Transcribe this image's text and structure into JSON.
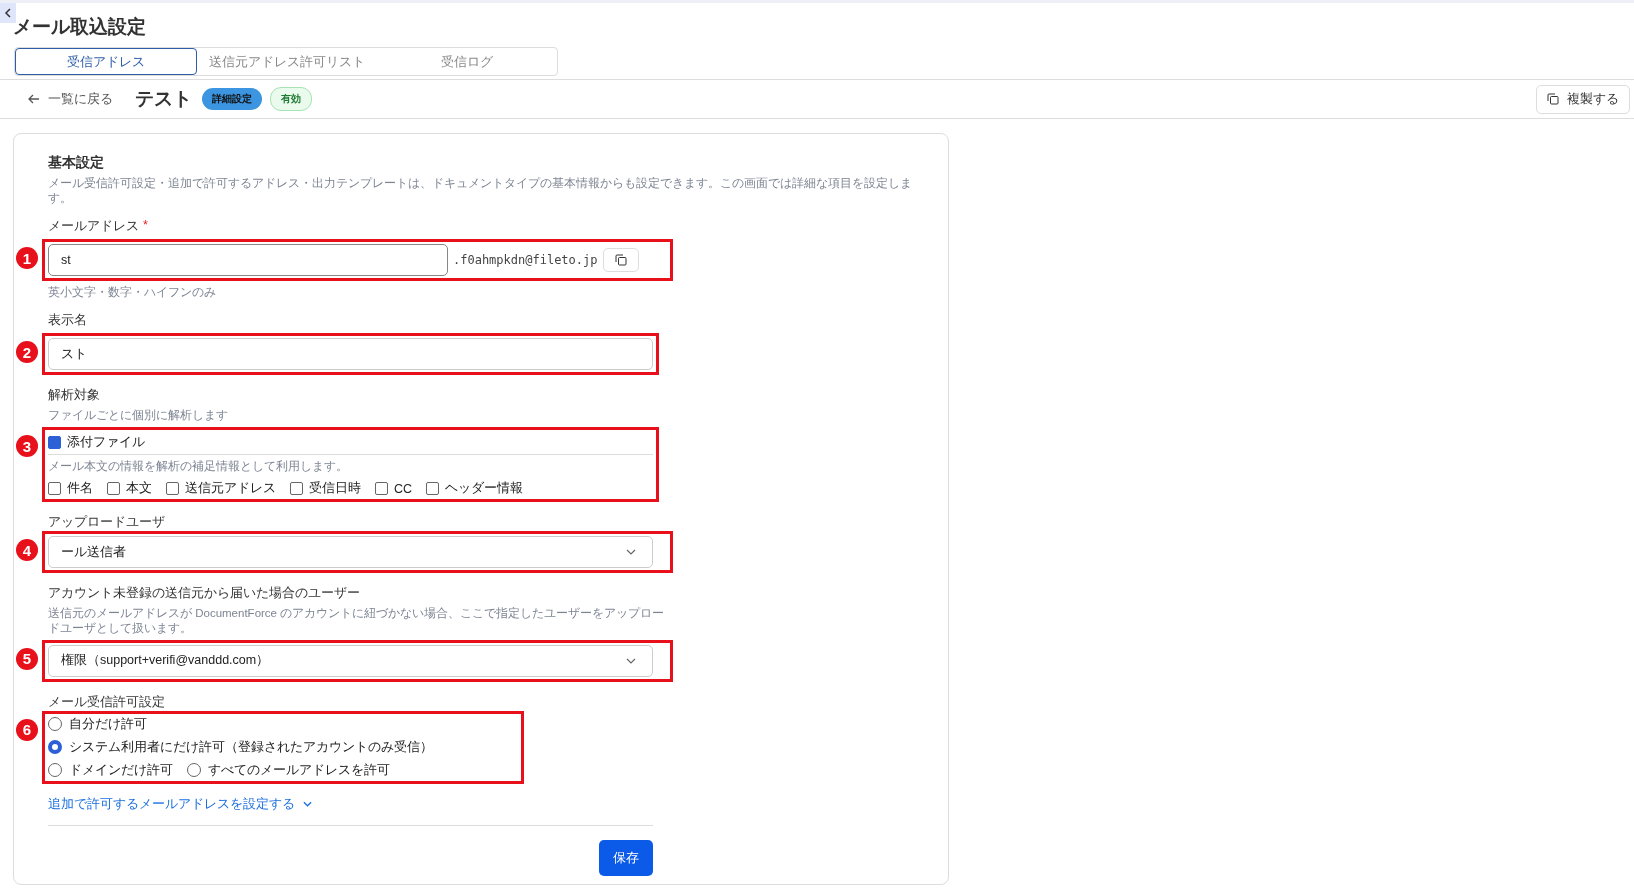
{
  "page_title": "メール取込設定",
  "tabs": [
    {
      "label": "受信アドレス",
      "selected": true
    },
    {
      "label": "送信元アドレス許可リスト",
      "selected": false
    },
    {
      "label": "受信ログ",
      "selected": false
    }
  ],
  "header": {
    "back_link": "一覧に戻る",
    "title": "テスト",
    "badges": [
      {
        "label": "詳細設定",
        "kind": "info"
      },
      {
        "label": "有効",
        "kind": "success"
      }
    ],
    "duplicate_button": "複製する"
  },
  "section": {
    "title": "基本設定",
    "description": "メール受信許可設定・追加で許可するアドレス・出力テンプレートは、ドキュメントタイプの基本情報からも設定できます。この画面では詳細な項目を設定します。"
  },
  "email": {
    "label": "メールアドレス",
    "required_mark": "*",
    "value": "st",
    "domain": ".f0ahmpkdn@fileto.jp",
    "hint": "英小文字・数字・ハイフンのみ",
    "annotation": "1"
  },
  "display_name": {
    "label": "表示名",
    "value": "スト",
    "annotation": "2"
  },
  "analysis": {
    "label": "解析対象",
    "description": "ファイルごとに個別に解析します",
    "attachment": {
      "label": "添付ファイル",
      "checked": true
    },
    "body_description": "メール本文の情報を解析の補足情報として利用します。",
    "options": [
      {
        "label": "件名",
        "checked": false
      },
      {
        "label": "本文",
        "checked": false
      },
      {
        "label": "送信元アドレス",
        "checked": false
      },
      {
        "label": "受信日時",
        "checked": false
      },
      {
        "label": "CC",
        "checked": false
      },
      {
        "label": "ヘッダー情報",
        "checked": false
      }
    ],
    "annotation": "3"
  },
  "upload_user": {
    "label": "アップロードユーザ",
    "value": "ール送信者",
    "annotation": "4"
  },
  "unregistered_user": {
    "label": "アカウント未登録の送信元から届いた場合のユーザー",
    "description": "送信元のメールアドレスが DocumentForce のアカウントに紐づかない場合、ここで指定したユーザーをアップロードユーザとして扱います。",
    "value": "権限（support+verifi@vanddd.com）",
    "annotation": "5"
  },
  "permission": {
    "label": "メール受信許可設定",
    "options": [
      {
        "label": "自分だけ許可",
        "selected": false
      },
      {
        "label": "システム利用者にだけ許可（登録されたアカウントのみ受信）",
        "selected": true
      },
      {
        "label": "ドメインだけ許可",
        "selected": false
      },
      {
        "label": "すべてのメールアドレスを許可",
        "selected": false
      }
    ],
    "annotation": "6"
  },
  "additional_link": "追加で許可するメールアドレスを設定する",
  "save_button": "保存"
}
